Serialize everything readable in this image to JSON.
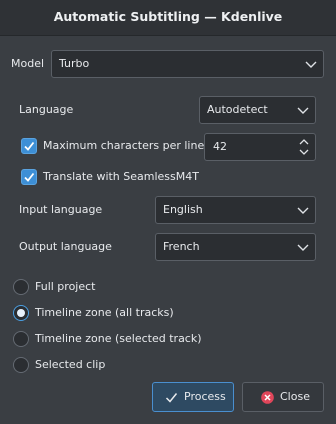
{
  "window": {
    "title": "Automatic Subtitling — Kdenlive"
  },
  "model": {
    "label": "Model",
    "value": "Turbo"
  },
  "language": {
    "label": "Language",
    "value": "Autodetect"
  },
  "max_chars": {
    "label": "Maximum characters per line",
    "value": "42",
    "checked": true
  },
  "translate": {
    "label": "Translate with SeamlessM4T",
    "checked": true
  },
  "input_language": {
    "label": "Input language",
    "value": "English"
  },
  "output_language": {
    "label": "Output language",
    "value": "French"
  },
  "zones": {
    "options": [
      {
        "label": "Full project",
        "checked": false
      },
      {
        "label": "Timeline zone (all tracks)",
        "checked": true
      },
      {
        "label": "Timeline zone (selected track)",
        "checked": false
      },
      {
        "label": "Selected clip",
        "checked": false
      }
    ]
  },
  "buttons": {
    "process": "Process",
    "close": "Close"
  },
  "colors": {
    "accent": "#3d8fd6",
    "close_icon": "#e0465a"
  }
}
